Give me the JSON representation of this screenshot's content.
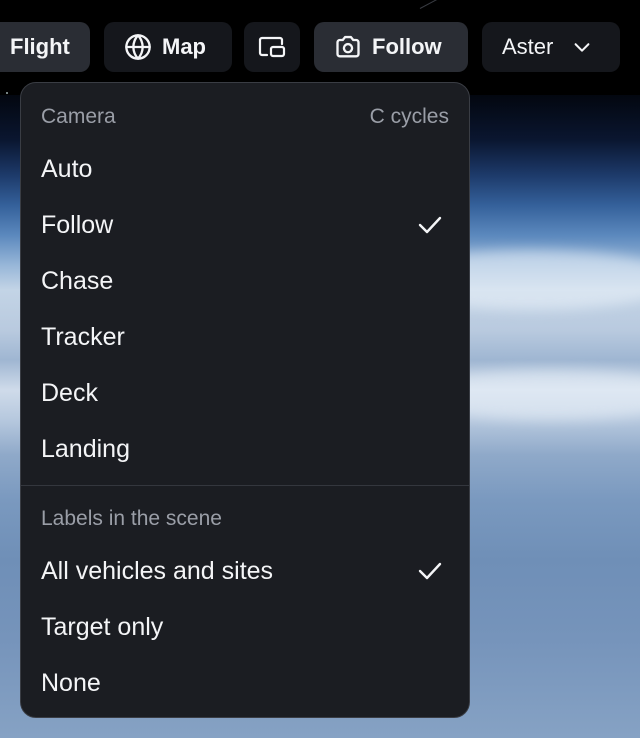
{
  "toolbar": {
    "flight_label": "Flight",
    "map_label": "Map",
    "map_icon": "globe-icon",
    "pip_icon": "picture-in-picture-icon",
    "follow_label": "Follow",
    "follow_icon": "camera-icon",
    "aster_label": "Aster",
    "aster_icon": "chevron-down-icon"
  },
  "camera_menu": {
    "header_label": "Camera",
    "header_hint": "C cycles",
    "items": [
      {
        "label": "Auto",
        "checked": false
      },
      {
        "label": "Follow",
        "checked": true
      },
      {
        "label": "Chase",
        "checked": false
      },
      {
        "label": "Tracker",
        "checked": false
      },
      {
        "label": "Deck",
        "checked": false
      },
      {
        "label": "Landing",
        "checked": false
      }
    ]
  },
  "labels_menu": {
    "header_label": "Labels in the scene",
    "items": [
      {
        "label": "All vehicles and sites",
        "checked": true
      },
      {
        "label": "Target only",
        "checked": false
      },
      {
        "label": "None",
        "checked": false
      }
    ]
  },
  "colors": {
    "menu_bg": "#1b1d22",
    "toolbar_bg": "#15171c",
    "active_bg": "#2a2d34",
    "text": "#f4f5f7",
    "muted_text": "#9a9ea7"
  }
}
